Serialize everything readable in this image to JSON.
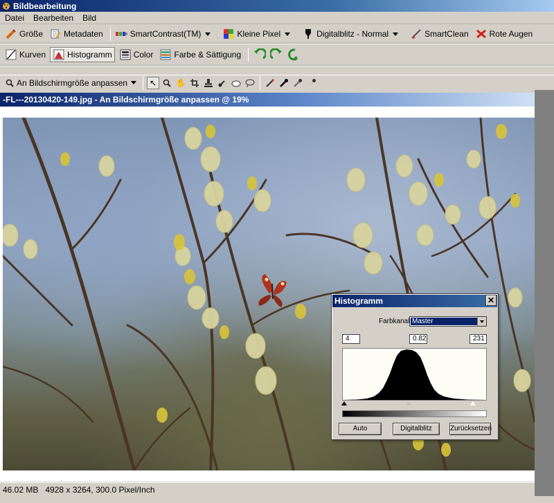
{
  "window": {
    "title": "Bildbearbeitung",
    "icon": "palette-icon"
  },
  "menu": [
    "Datei",
    "Bearbeiten",
    "Bild"
  ],
  "toolbar1": [
    {
      "label": "Größe",
      "icon": "resize-icon",
      "dropdown": false
    },
    {
      "label": "Metadaten",
      "icon": "metadata-icon",
      "dropdown": false
    },
    {
      "label": "SmartContrast(TM)",
      "icon": "smartcontrast-icon",
      "dropdown": true
    },
    {
      "label": "Kleine Pixel",
      "icon": "small-pixel-icon",
      "dropdown": true
    },
    {
      "label": "Digitalblitz - Normal",
      "icon": "flash-icon",
      "dropdown": true
    },
    {
      "label": "SmartClean",
      "icon": "smartclean-icon",
      "dropdown": false
    },
    {
      "label": "Rote Augen",
      "icon": "red-eye-icon",
      "dropdown": false
    }
  ],
  "toolbar2": [
    {
      "label": "Kurven",
      "icon": "curves-icon",
      "active": false
    },
    {
      "label": "Histogramm",
      "icon": "histogram-icon",
      "active": true
    },
    {
      "label": "Color",
      "icon": "color-icon",
      "active": false
    },
    {
      "label": "Farbe & Sättigung",
      "icon": "saturation-icon",
      "active": false
    }
  ],
  "toolbar3": {
    "zoom_label": "An Bildschirmgröße anpassen",
    "tools": [
      "pointer-icon",
      "zoom-icon",
      "hand-icon",
      "crop-icon",
      "stamp-icon",
      "brush-icon",
      "eraser-icon",
      "lasso-icon"
    ],
    "eyedroppers": [
      "wand-icon",
      "eyedropper-black-icon",
      "eyedropper-gray-icon",
      "eyedropper-white-icon"
    ]
  },
  "document": {
    "header": "-FL---20130420-149.jpg - An Bildschirmgröße anpassen @ 19%"
  },
  "status": {
    "filesize": "46.02 MB",
    "dimensions": "4928 x 3264, 300.0 Pixel/Inch"
  },
  "histogram_dialog": {
    "title": "Histogramm",
    "channel_label": "Farbkanal:",
    "channel_value": "Master",
    "black_point": "4",
    "gamma": "0.82",
    "white_point": "231",
    "buttons": {
      "auto": "Auto",
      "flash": "Digitalblitz",
      "reset": "Zurücksetzen"
    },
    "slider_positions": {
      "black": 4,
      "gamma": 0.82,
      "white": 231
    }
  },
  "colors": {
    "title_dark": "#0a246a",
    "title_light": "#a6caf0",
    "chrome": "#d4d0c8"
  }
}
